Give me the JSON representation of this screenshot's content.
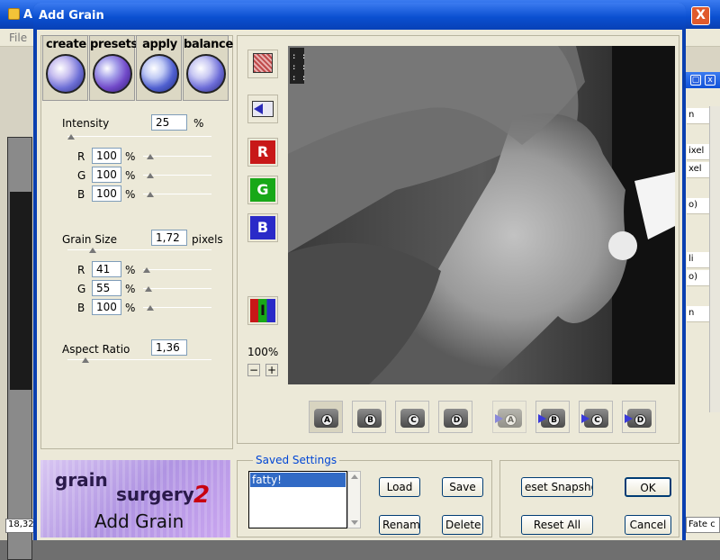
{
  "host": {
    "title_fragment": "A",
    "menu_file": "File",
    "coords_fragment": "18,32",
    "panel_items": [
      "n",
      "ixel",
      "xel",
      "o)",
      "li",
      "o)",
      "n"
    ],
    "status_fragment": "Fate c",
    "win_close": "X"
  },
  "dialog": {
    "title": "Add Grain",
    "tabs": [
      {
        "label": "create"
      },
      {
        "label": "presets"
      },
      {
        "label": "apply"
      },
      {
        "label": "balance"
      }
    ],
    "intensity": {
      "label": "Intensity",
      "value": "25",
      "unit": "%",
      "channels": [
        {
          "name": "R",
          "value": "100",
          "unit": "%"
        },
        {
          "name": "G",
          "value": "100",
          "unit": "%"
        },
        {
          "name": "B",
          "value": "100",
          "unit": "%"
        }
      ]
    },
    "grain_size": {
      "label": "Grain Size",
      "value": "1,72",
      "unit": "pixels",
      "channels": [
        {
          "name": "R",
          "value": "41",
          "unit": "%"
        },
        {
          "name": "G",
          "value": "55",
          "unit": "%"
        },
        {
          "name": "B",
          "value": "100",
          "unit": "%"
        }
      ]
    },
    "aspect_ratio": {
      "label": "Aspect Ratio",
      "value": "1,36"
    },
    "side_buttons": {
      "r": "R",
      "g": "G",
      "b": "B",
      "i": "I"
    },
    "zoom": {
      "value": "100%",
      "minus": "−",
      "plus": "+"
    },
    "snapshots": [
      "A",
      "B",
      "C",
      "D"
    ],
    "compare": [
      "A",
      "B",
      "C",
      "D"
    ],
    "saved_settings": {
      "title": "Saved Settings",
      "items": [
        "fatty!"
      ],
      "load": "Load",
      "save": "Save",
      "rename": "Rename",
      "delete": "Delete"
    },
    "reset_snapshot": "eset Snapsho",
    "reset_all": "Reset All",
    "ok": "OK",
    "cancel": "Cancel",
    "logo": {
      "brand1": "grain",
      "brand2": "surgery",
      "version": "2",
      "caption": "Add Grain"
    }
  }
}
